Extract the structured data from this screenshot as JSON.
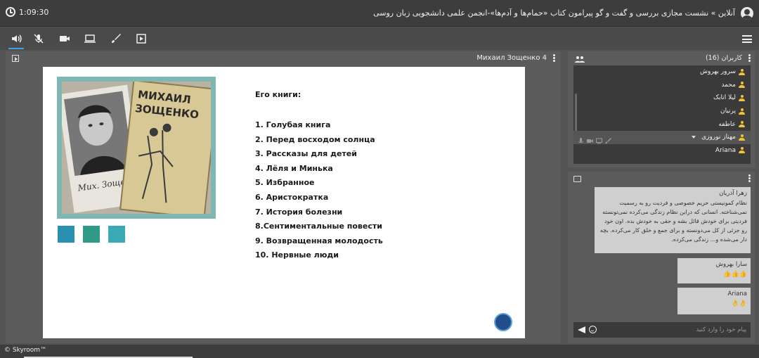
{
  "header": {
    "timer": "1:09:30",
    "room_title": "آنلاین » نشست مجازی بررسی و گفت و گو پیرامون کتاب «حمام‌ها و آدم‌ها»-انجمن علمی دانشجویی زبان روسی"
  },
  "toolbar": {
    "icons": [
      "speaker-icon",
      "mic-off-icon",
      "camera-icon",
      "screen-share-icon",
      "brush-icon",
      "presentation-icon",
      "menu-icon"
    ]
  },
  "presentation": {
    "file_title": "Михаил Зощенко 4",
    "photo_text": {
      "name_line1": "МИХАИЛ",
      "name_line2": "ЗОЩЕНКО",
      "signature": "Мих. Зощен"
    },
    "heading": "Его книги:",
    "books": [
      "1. Голубая книга",
      "2. Перед восходом солнца",
      "3. Рассказы для детей",
      "4. Лёля и Минька",
      "5. Избранное",
      "6. Аристократка",
      "7. История болезни",
      "8.Сентиментальные повести",
      "9. Возвращенная молодость",
      "10. Нервные люди"
    ]
  },
  "users": {
    "title": "کاربران (16)",
    "list": [
      {
        "name": "سرور بهروش"
      },
      {
        "name": "محمد"
      },
      {
        "name": "لیلا اتابک"
      },
      {
        "name": "پرنیان"
      },
      {
        "name": "عاطفه"
      },
      {
        "name": "مهناز نوروزی"
      },
      {
        "name": "Ariana"
      }
    ]
  },
  "chat": {
    "messages": [
      {
        "sender": "زهرا آذریان",
        "text": "نظام کمونیستی حریم خصوصی و فردیت رو به رسمیت نمی‌شناخته. انسانی که دراین نظام زندگی می‌کرده نمی‌تونسته فردیتی برای خودش قائل بشه و حقی به خودش بده. اون خود رو جزئی از کل می‌دونسته و برای جمع و خلق کار می‌کرده. بچه دار می‌شده و... زندگی می‌کرده."
      },
      {
        "sender": "سارا بهروش",
        "text": "👍👍👍"
      },
      {
        "sender": "Ariana",
        "text": "👌👌"
      }
    ],
    "input_placeholder": "پیام خود را وارد کنید"
  },
  "footer": {
    "copyright": "© Skyroom™"
  },
  "colors": {
    "accent": "#3aa3e3",
    "user_icon": "#f2c230",
    "panel_bg": "#5b5b5b"
  }
}
